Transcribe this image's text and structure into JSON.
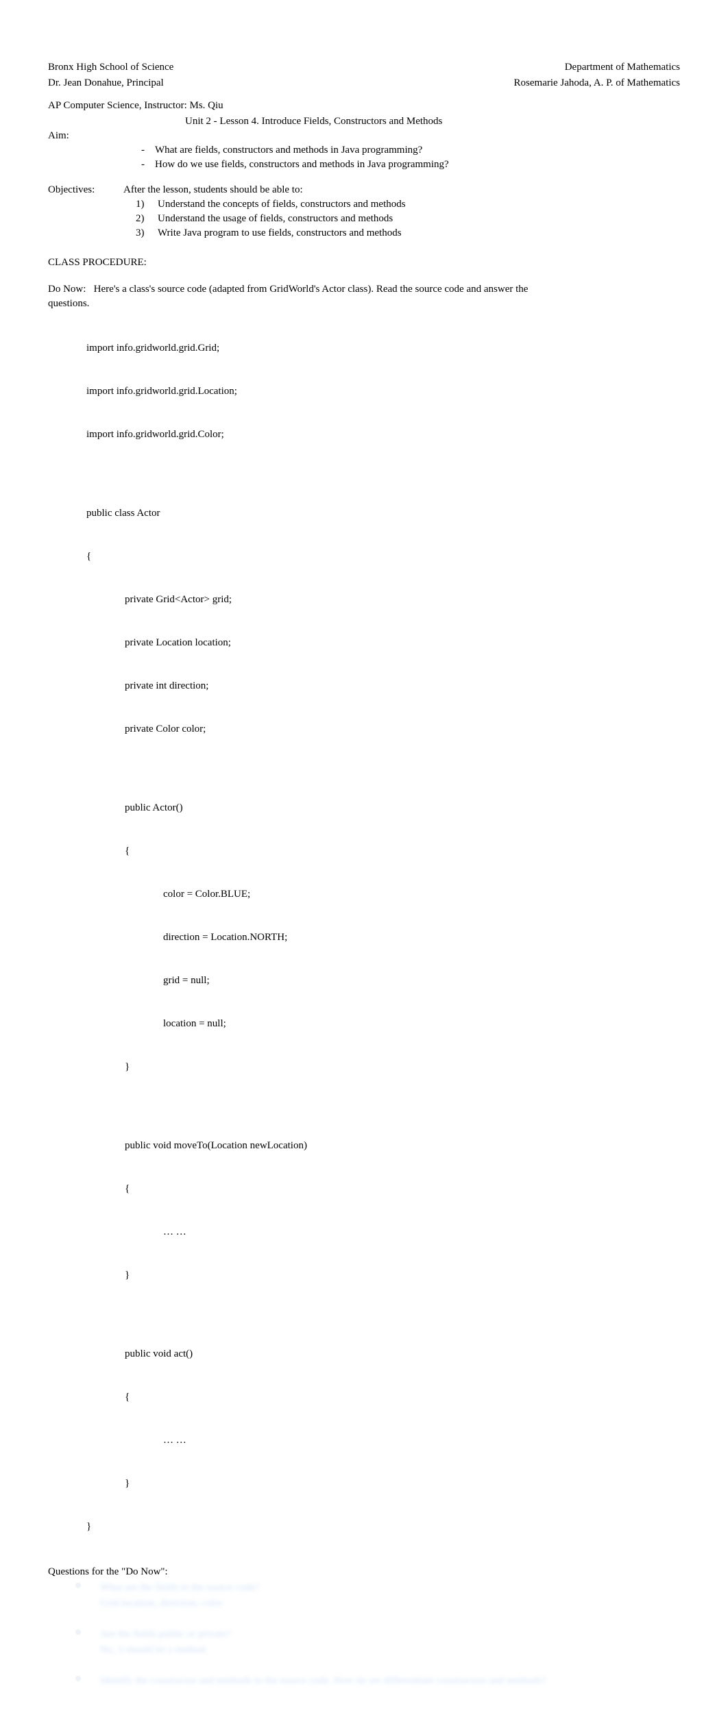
{
  "header": {
    "school": "Bronx High School of Science",
    "principal": "Dr. Jean Donahue, Principal",
    "department": "Department of Mathematics",
    "ap": "Rosemarie Jahoda, A. P. of Mathematics"
  },
  "course": "AP Computer Science, Instructor: Ms. Qiu",
  "lesson_title": "Unit 2 - Lesson 4. Introduce Fields, Constructors and Methods",
  "aim": {
    "label": "Aim:",
    "bullets": [
      "What are fields, constructors and methods in Java programming?",
      "How do we use fields, constructors and methods in Java programming?"
    ]
  },
  "objectives": {
    "label": "Objectives:",
    "intro": "After the lesson, students should be able to:",
    "items": [
      {
        "num": "1)",
        "text": "Understand the concepts of fields, constructors and methods"
      },
      {
        "num": "2)",
        "text": "Understand the usage of fields, constructors and methods"
      },
      {
        "num": "3)",
        "text": "Write Java program to use fields, constructors and methods"
      }
    ]
  },
  "class_procedure": "CLASS PROCEDURE:",
  "donow": {
    "label": "Do Now:",
    "text": "Here's a class's source code (adapted from GridWorld's Actor class). Read the source code and answer the",
    "text2": "questions."
  },
  "code": {
    "l1": "import info.gridworld.grid.Grid;",
    "l2": "import info.gridworld.grid.Location;",
    "l3": "import info.gridworld.grid.Color;",
    "l4": "public class Actor",
    "l5": "{",
    "l6": "private Grid<Actor> grid;",
    "l7": "private Location location;",
    "l8": "private int direction;",
    "l9": "private Color color;",
    "l10": "public Actor()",
    "l11": "{",
    "l12": "color = Color.BLUE;",
    "l13": "direction = Location.NORTH;",
    "l14": "grid = null;",
    "l15": "location = null;",
    "l16": "}",
    "l17": "public void moveTo(Location newLocation)",
    "l18": "{",
    "l19": "… …",
    "l20": "}",
    "l21": "public void act()",
    "l22": "{",
    "l23": "… …",
    "l24": "}",
    "l25": "}"
  },
  "questions": {
    "header": "Questions for the \"Do Now\":",
    "q1a": "What are the fields in the source code?",
    "q1b": "Grid location, direction, color",
    "q2a": "Are the fields public or private?",
    "q2b": "No, 3 should be a method",
    "q3a": "Identify the constructor and methods in the source code. How do we differentiate constructors and methods?"
  }
}
